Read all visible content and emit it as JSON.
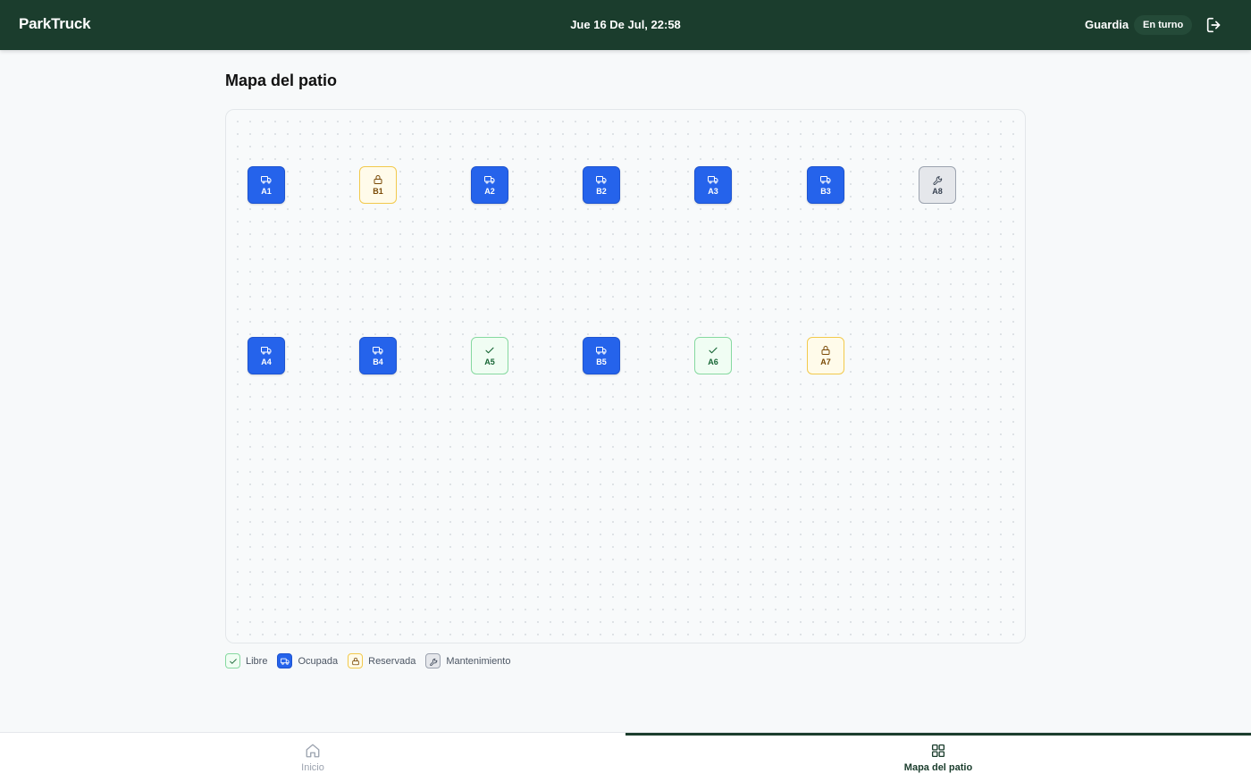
{
  "header": {
    "brand": "ParkTruck",
    "datetime": "Jue 16 De Jul, 22:58",
    "role": "Guardia",
    "shift_badge": "En turno",
    "logout_icon": "logout-icon"
  },
  "page": {
    "title": "Mapa del patio"
  },
  "colors": {
    "header_bg": "#1b3d2d",
    "occupied": "#2563eb",
    "reserved": "#f2c94c",
    "free": "#86d9a0",
    "maintenance": "#9ca3af"
  },
  "spots": {
    "A1": {
      "code": "A1",
      "status": "occupied",
      "icon": "truck-icon"
    },
    "B1": {
      "code": "B1",
      "status": "reserved",
      "icon": "lock-icon"
    },
    "A2": {
      "code": "A2",
      "status": "occupied",
      "icon": "truck-icon"
    },
    "B2": {
      "code": "B2",
      "status": "occupied",
      "icon": "truck-icon"
    },
    "A3": {
      "code": "A3",
      "status": "occupied",
      "icon": "truck-icon"
    },
    "B3": {
      "code": "B3",
      "status": "occupied",
      "icon": "truck-icon"
    },
    "A8": {
      "code": "A8",
      "status": "maintenance",
      "icon": "wrench-icon"
    },
    "A4": {
      "code": "A4",
      "status": "occupied",
      "icon": "truck-icon"
    },
    "B4": {
      "code": "B4",
      "status": "occupied",
      "icon": "truck-icon"
    },
    "A5": {
      "code": "A5",
      "status": "free",
      "icon": "check-icon"
    },
    "B5": {
      "code": "B5",
      "status": "occupied",
      "icon": "truck-icon"
    },
    "A6": {
      "code": "A6",
      "status": "free",
      "icon": "check-icon"
    },
    "A7": {
      "code": "A7",
      "status": "reserved",
      "icon": "lock-icon"
    }
  },
  "legend": {
    "free": "Libre",
    "occupied": "Ocupada",
    "reserved": "Reservada",
    "maintenance": "Mantenimiento"
  },
  "nav": {
    "home": {
      "label": "Inicio",
      "icon": "home-icon"
    },
    "map": {
      "label": "Mapa del patio",
      "icon": "grid-icon",
      "active": true
    }
  }
}
